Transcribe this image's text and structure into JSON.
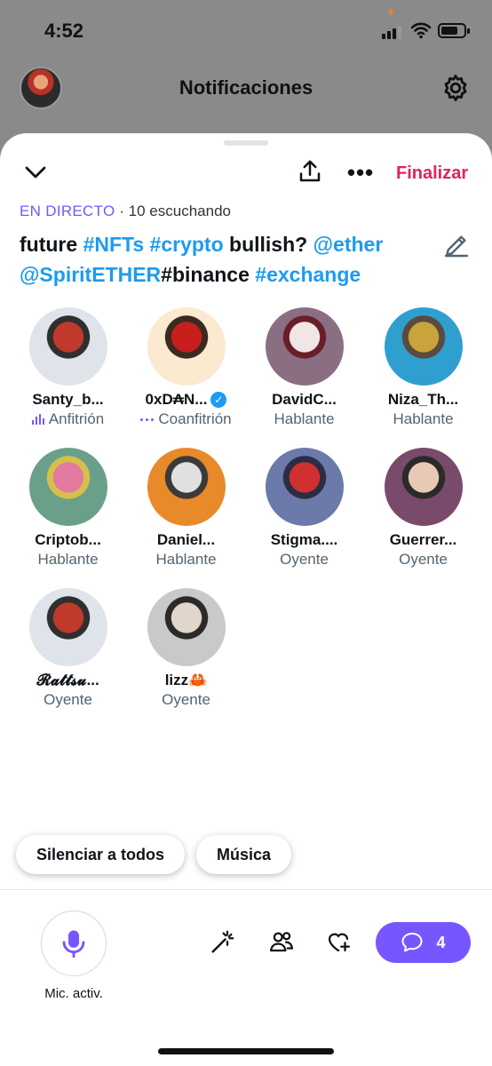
{
  "status_bar": {
    "time": "4:52"
  },
  "header": {
    "title": "Notificaciones"
  },
  "space": {
    "finalize_label": "Finalizar",
    "live_label": "EN DIRECTO",
    "listening": "· 10 escuchando",
    "title_parts": [
      {
        "text": "future ",
        "tag": false
      },
      {
        "text": "#NFTs",
        "tag": true
      },
      {
        "text": " ",
        "tag": false
      },
      {
        "text": "#crypto",
        "tag": true
      },
      {
        "text": " bullish?  ",
        "tag": false
      },
      {
        "text": "@ether",
        "tag": true
      },
      {
        "text": " ",
        "tag": false
      },
      {
        "text": "@SpiritETHER",
        "tag": true
      },
      {
        "text": "#binance",
        "tag": false
      },
      {
        "text": " ",
        "tag": false
      },
      {
        "text": "#exchange",
        "tag": true
      }
    ]
  },
  "participants": [
    {
      "name": "Santy_b...",
      "role": "Anfitrión",
      "badge": "host",
      "colors": [
        "#dfe3ea",
        "#c0392b",
        "#2f2f2f"
      ]
    },
    {
      "name": "0xD₳N...",
      "role": "Coanfitrión",
      "badge": "cohost",
      "verified": true,
      "colors": [
        "#fbe9d0",
        "#c81e1e",
        "#3a2a20"
      ]
    },
    {
      "name": "DavidC...",
      "role": "Hablante",
      "colors": [
        "#8a6f83",
        "#f0e6e6",
        "#6a1e2a"
      ]
    },
    {
      "name": "Niza_Th...",
      "role": "Hablante",
      "colors": [
        "#2f9fd0",
        "#c9a43a",
        "#5c4a3e"
      ]
    },
    {
      "name": "Criptob...",
      "role": "Hablante",
      "colors": [
        "#6aa08a",
        "#e27aa0",
        "#d6c04a"
      ]
    },
    {
      "name": "Daniel...",
      "role": "Hablante",
      "colors": [
        "#e88a2a",
        "#e0e0e0",
        "#3a3a3a"
      ]
    },
    {
      "name": "Stigma....",
      "role": "Oyente",
      "colors": [
        "#6b7aa8",
        "#d03030",
        "#2c2c44"
      ]
    },
    {
      "name": "Guerrer...",
      "role": "Oyente",
      "colors": [
        "#7a4a6a",
        "#e7c9b4",
        "#2a2a2a"
      ]
    },
    {
      "name": "𝓡𝓪𝓽𝓽𝓼𝓾...",
      "role": "Oyente",
      "colors": [
        "#dfe3ea",
        "#c0392b",
        "#2f2f2f"
      ]
    },
    {
      "name": "lizz🦀",
      "role": "Oyente",
      "colors": [
        "#c9c9c9",
        "#e0d6cc",
        "#2a2a2a"
      ]
    }
  ],
  "chips": {
    "mute_all": "Silenciar a todos",
    "music": "Música"
  },
  "bottom_bar": {
    "mic_label": "Mic. activ.",
    "chat_count": "4"
  },
  "theme": {
    "accent": "#7856ff",
    "link": "#1d9bf0",
    "danger": "#e0245e"
  }
}
